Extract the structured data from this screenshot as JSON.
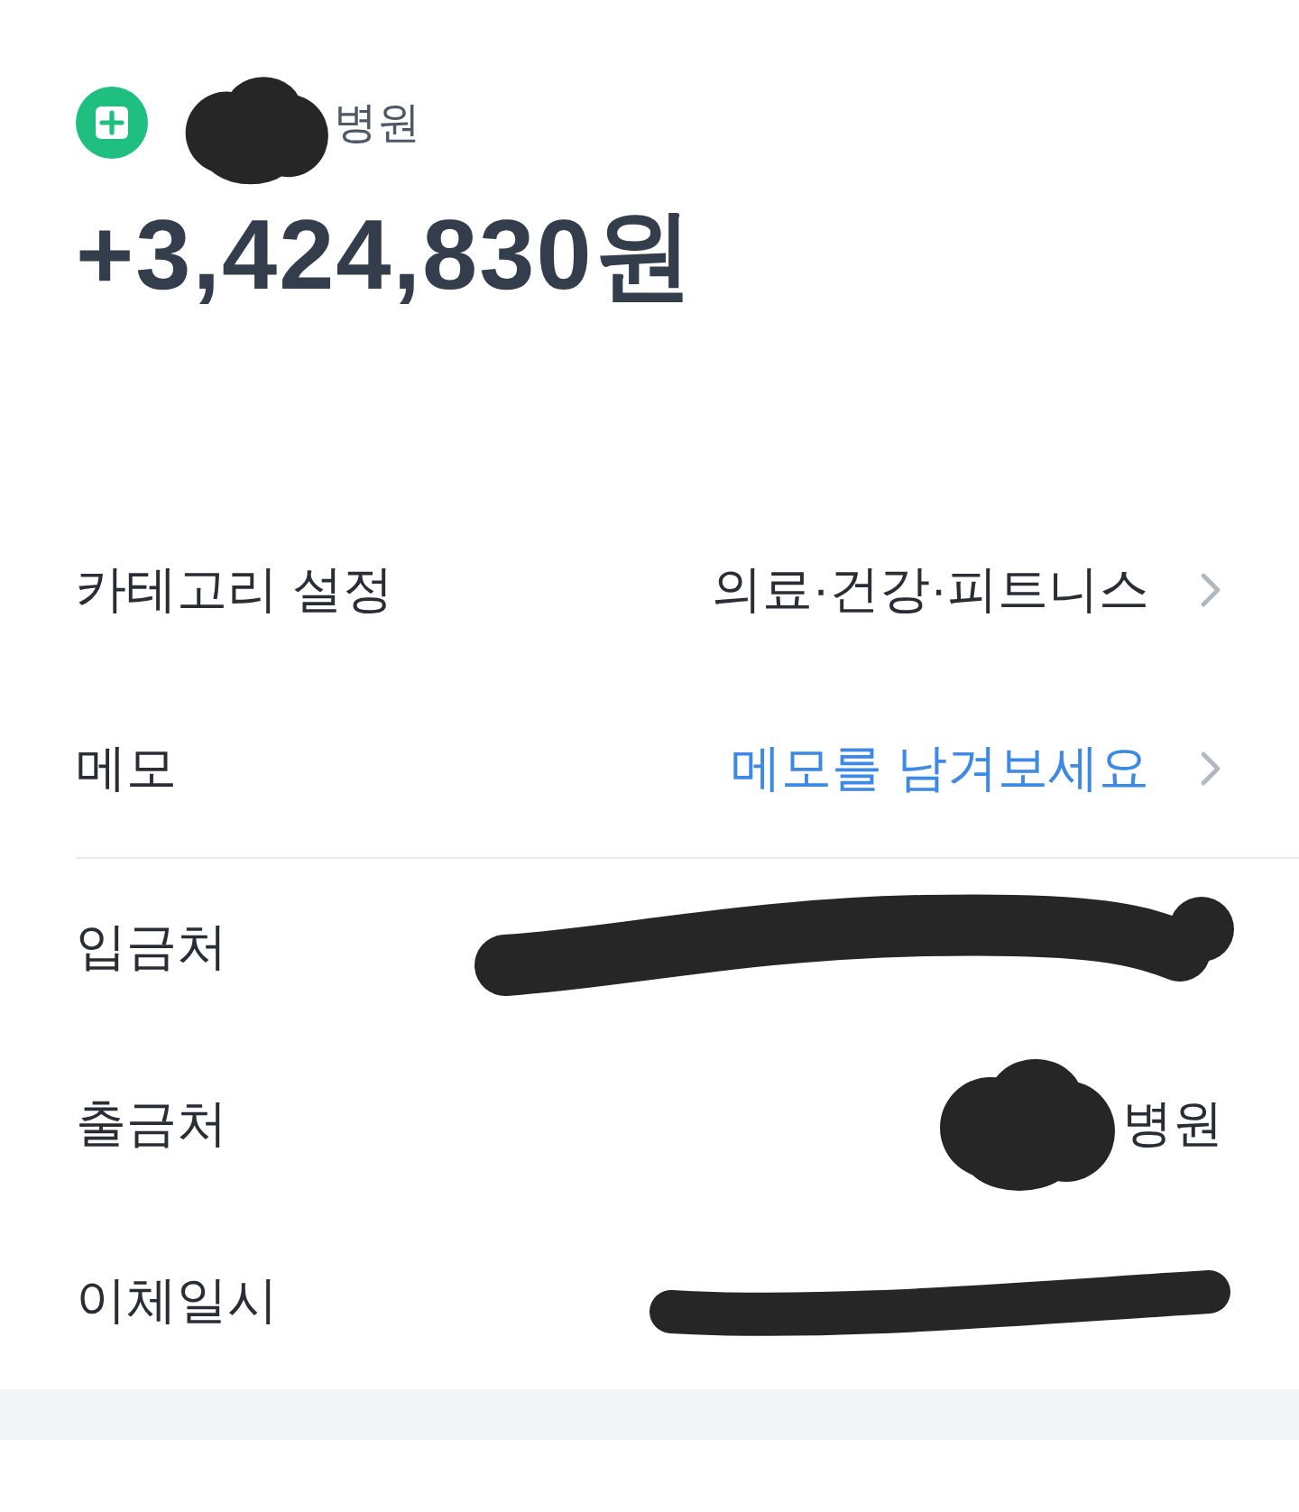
{
  "header": {
    "name": "병원",
    "redacted": true
  },
  "amount": "+3,424,830원",
  "settings": [
    {
      "label": "카테고리 설정",
      "value": "의료·건강·피트니스",
      "chevron": true
    },
    {
      "label": "메모",
      "placeholder": "메모를 남겨보세요",
      "chevron": true
    }
  ],
  "details": [
    {
      "label": "입금처",
      "redacted": true,
      "chevron": false
    },
    {
      "label": "출금처",
      "value": "병원",
      "redacted": true,
      "chevron": false
    },
    {
      "label": "이체일시",
      "redacted": true,
      "chevron": false
    }
  ]
}
